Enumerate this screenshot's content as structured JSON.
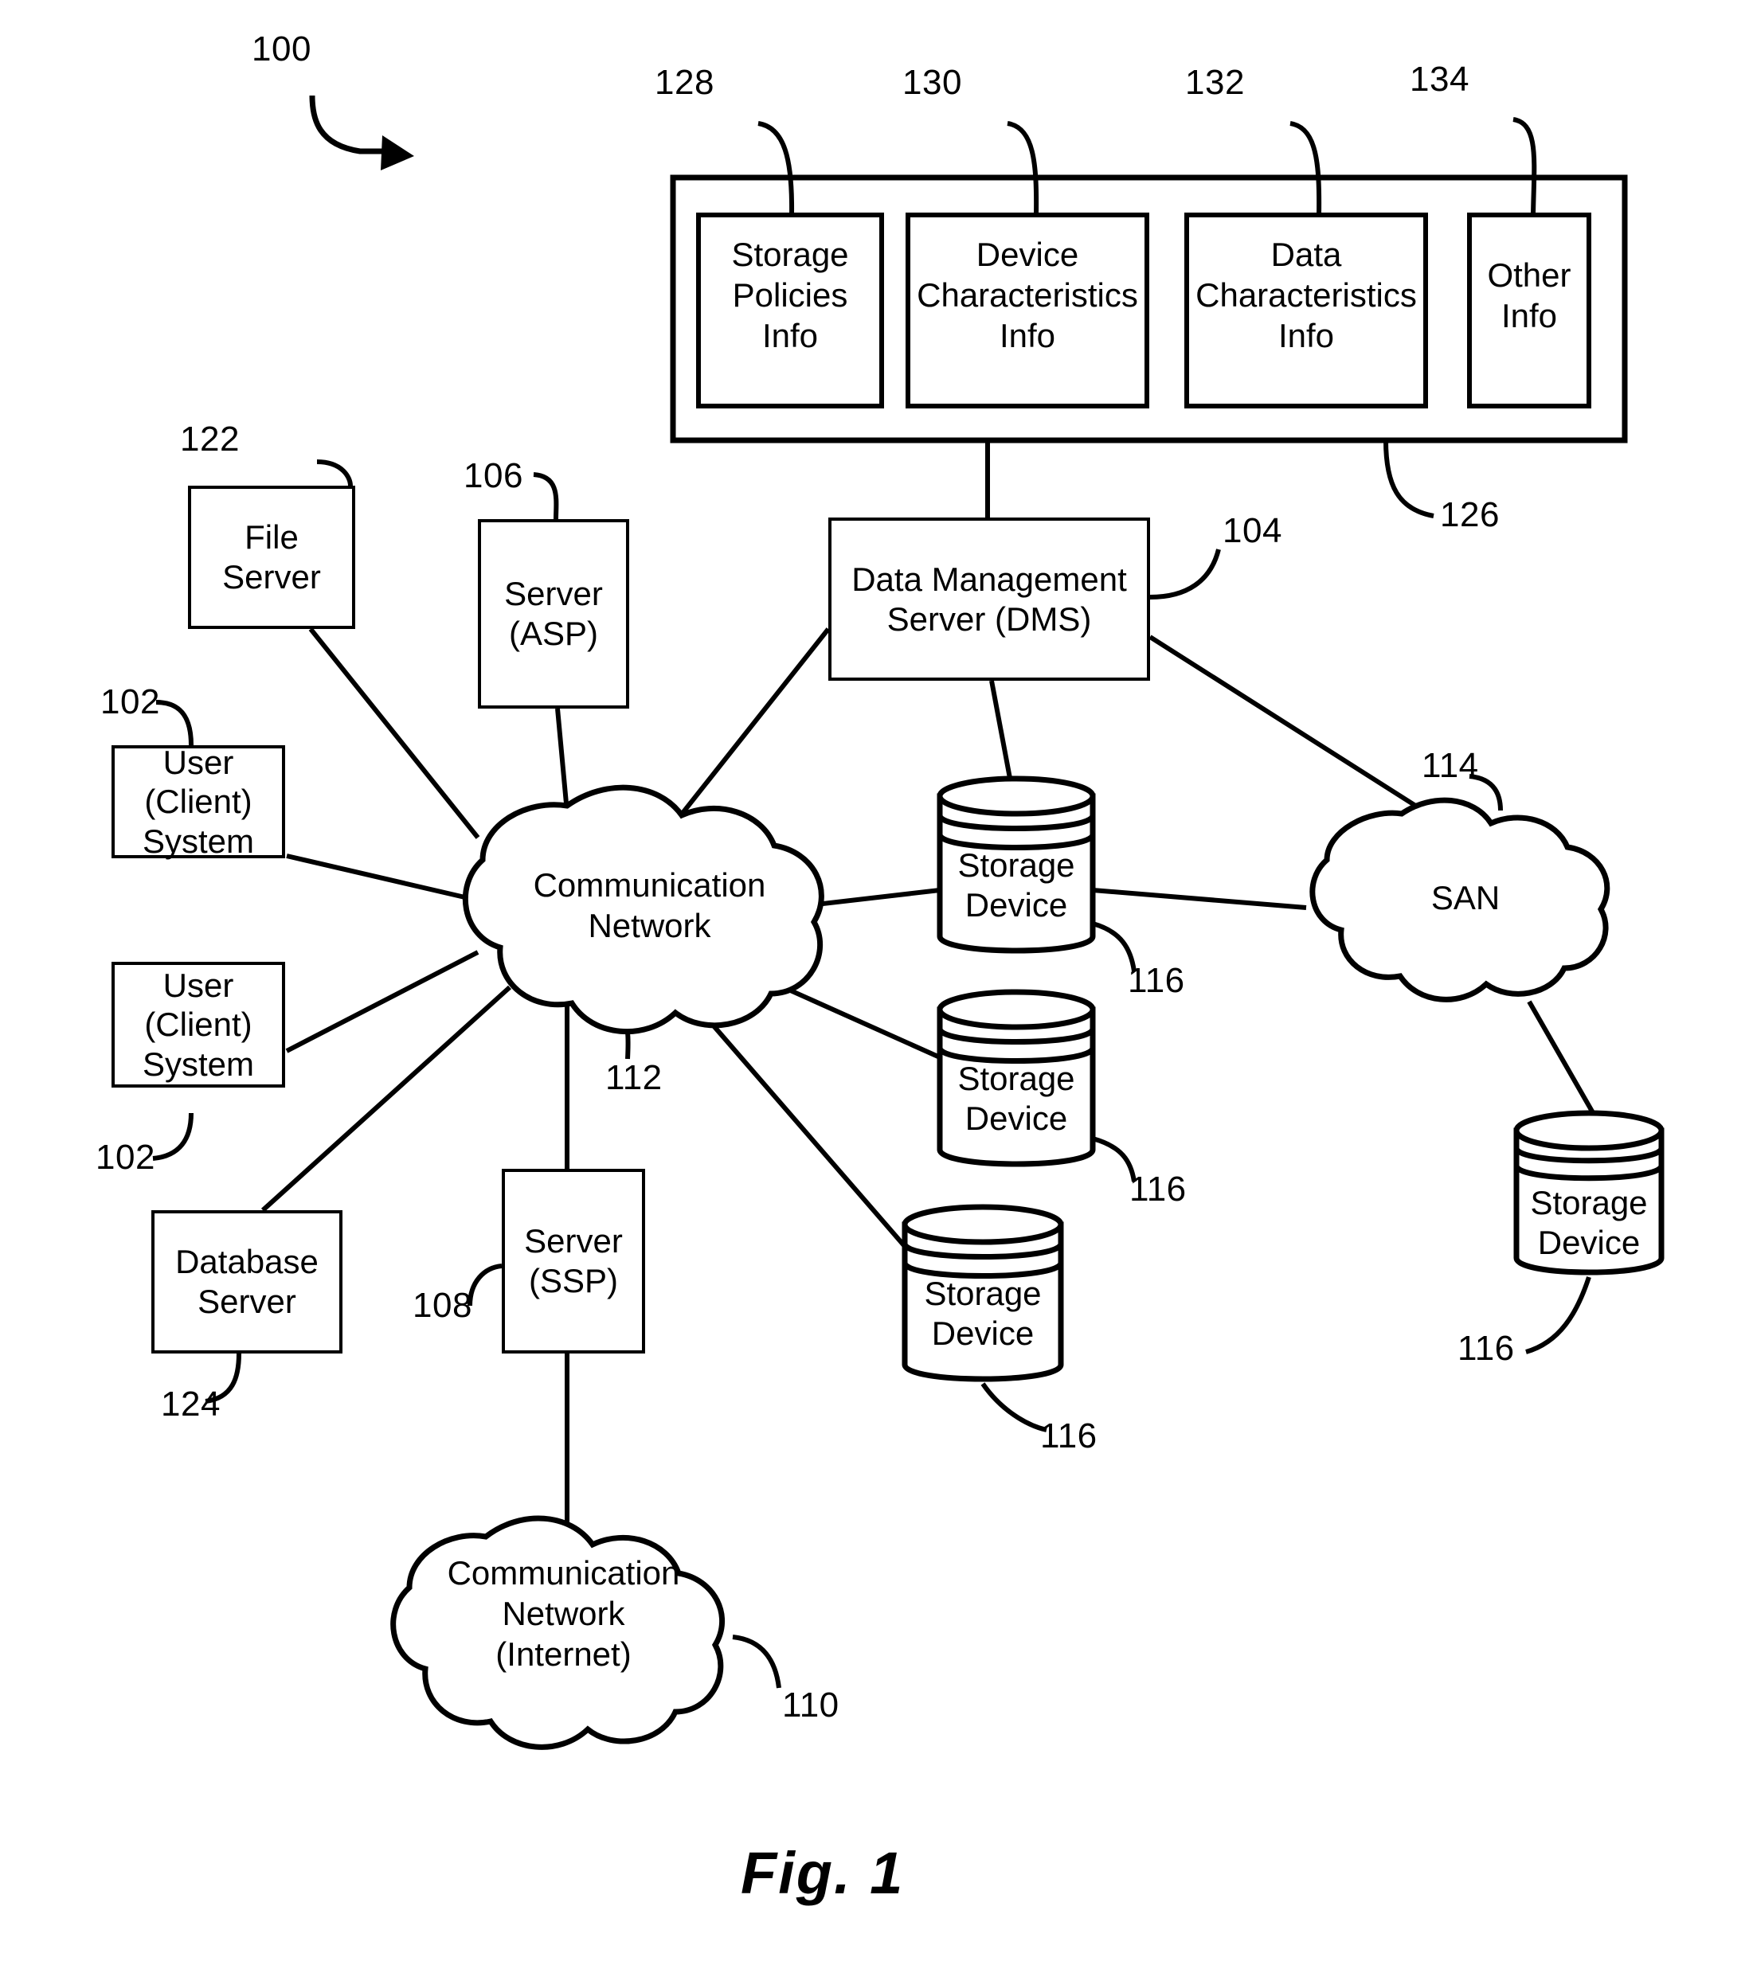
{
  "figure": {
    "caption": "Fig. 1",
    "system_ref": "100"
  },
  "top_container": {
    "ref": "126",
    "boxes": [
      {
        "ref": "128",
        "label": "Storage\nPolicies\nInfo"
      },
      {
        "ref": "130",
        "label": "Device\nCharacteristics\nInfo"
      },
      {
        "ref": "132",
        "label": "Data\nCharacteristics\nInfo"
      },
      {
        "ref": "134",
        "label": "Other\nInfo"
      }
    ]
  },
  "nodes": {
    "dms": {
      "ref": "104",
      "label": "Data Management\nServer (DMS)"
    },
    "file_server": {
      "ref": "122",
      "label": "File\nServer"
    },
    "server_asp": {
      "ref": "106",
      "label": "Server\n(ASP)"
    },
    "user_client_1": {
      "ref": "102",
      "label": "User\n(Client)\nSystem"
    },
    "user_client_2": {
      "ref": "102",
      "label": "User\n(Client)\nSystem"
    },
    "database_server": {
      "ref": "124",
      "label": "Database\nServer"
    },
    "server_ssp": {
      "ref": "108",
      "label": "Server\n(SSP)"
    }
  },
  "clouds": {
    "comm_network": {
      "ref": "112",
      "label": "Communication\nNetwork"
    },
    "san": {
      "ref": "114",
      "label": "SAN"
    },
    "internet": {
      "ref": "110",
      "label": "Communication\nNetwork\n(Internet)"
    }
  },
  "storage_devices": [
    {
      "ref": "116",
      "label": "Storage\nDevice"
    },
    {
      "ref": "116",
      "label": "Storage\nDevice"
    },
    {
      "ref": "116",
      "label": "Storage\nDevice"
    },
    {
      "ref": "116",
      "label": "Storage\nDevice"
    }
  ],
  "colors": {
    "stroke": "#000000",
    "background": "#ffffff"
  }
}
